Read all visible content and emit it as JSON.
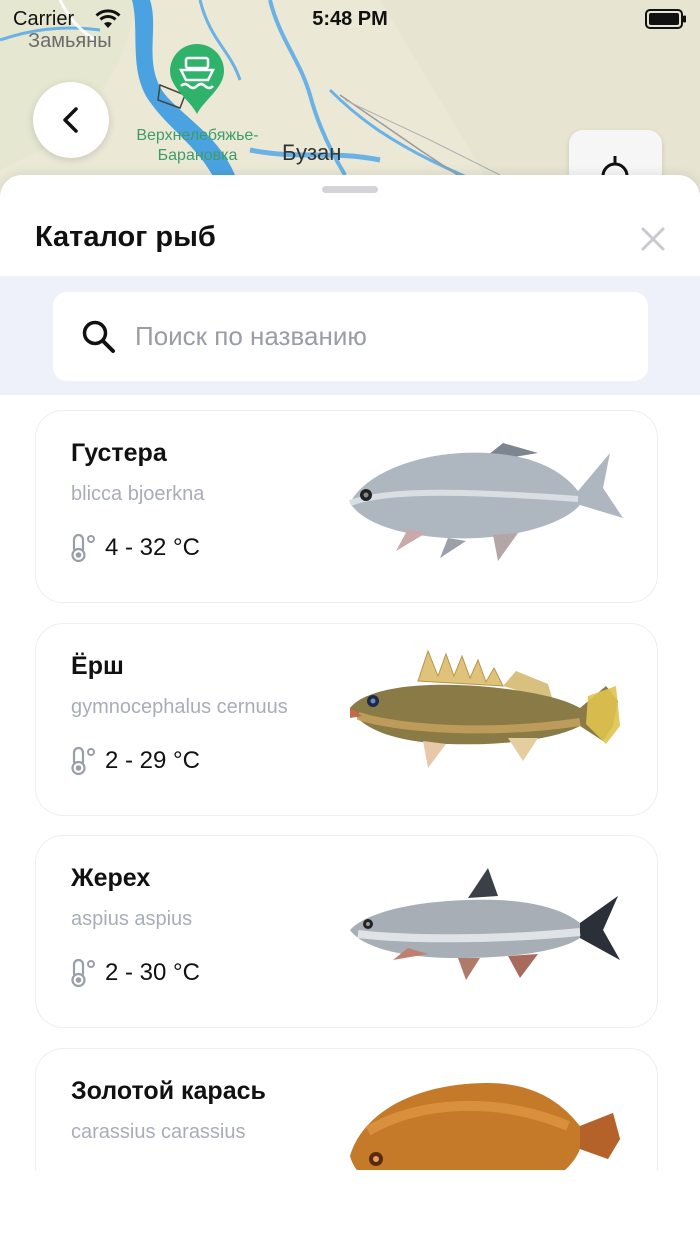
{
  "status_bar": {
    "carrier": "Carrier",
    "time": "5:48 PM"
  },
  "map": {
    "labels": {
      "village1": "Замьяны",
      "village2_line1": "Верхнелебяжье-",
      "village2_line2": "Барановка",
      "town": "Бузан"
    }
  },
  "sheet": {
    "title": "Каталог рыб",
    "search": {
      "placeholder": "Поиск по названию",
      "value": ""
    }
  },
  "fish": [
    {
      "name": "Густера",
      "latin": "blicca bjoerkna",
      "temp": "4 - 32 °C",
      "image": "white-bream"
    },
    {
      "name": "Ёрш",
      "latin": "gymnocephalus cernuus",
      "temp": "2 - 29 °C",
      "image": "ruffe"
    },
    {
      "name": "Жерех",
      "latin": "aspius aspius",
      "temp": "2 - 30 °C",
      "image": "asp"
    },
    {
      "name": "Золотой карась",
      "latin": "carassius carassius",
      "temp": "",
      "image": "crucian-carp"
    }
  ],
  "colors": {
    "accent_pin": "#2fb36a",
    "river": "#4aa3e0",
    "search_band": "#eef1fa"
  }
}
